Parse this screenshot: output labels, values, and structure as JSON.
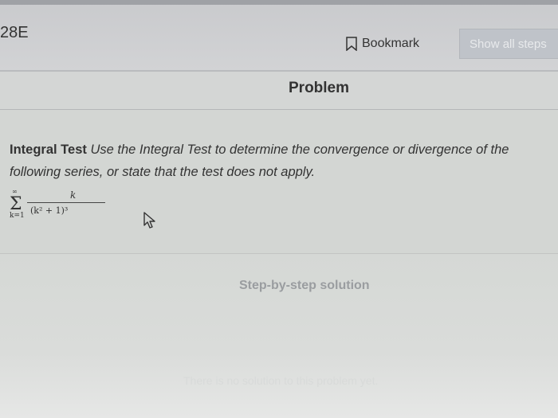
{
  "header": {
    "problem_number": "28E",
    "bookmark_label": "Bookmark",
    "bookmark_icon": "bookmark-icon",
    "show_steps_label": "Show all steps"
  },
  "tabs": {
    "active": "Problem"
  },
  "problem": {
    "term": "Integral Test",
    "description": "Use the Integral Test to determine the convergence or divergence of the following series, or state that the test does not apply.",
    "formula": {
      "sum_symbol": "Σ",
      "upper": "∞",
      "lower": "k=1",
      "numerator": "k",
      "denominator": "(k² + 1)³"
    }
  },
  "solution": {
    "heading": "Step-by-step solution",
    "empty_message": "There is no solution to this problem yet."
  },
  "colors": {
    "header_bg": "#c9cacd",
    "content_bg": "#d3d6d3",
    "muted_text": "#9a9da0"
  }
}
